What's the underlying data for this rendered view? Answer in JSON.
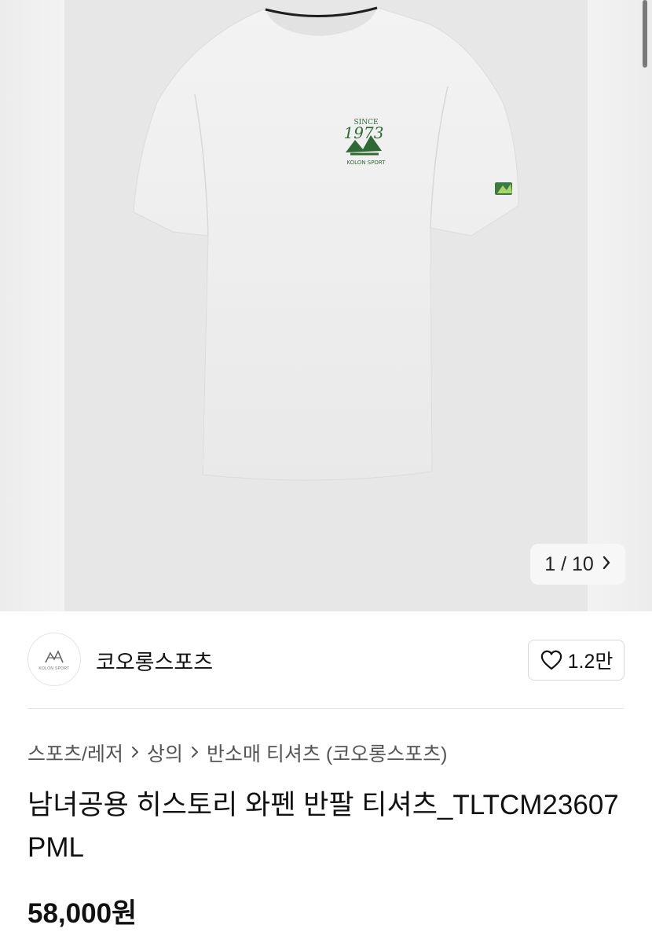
{
  "gallery": {
    "counter_current": "1",
    "counter_sep": "/",
    "counter_total": "10",
    "next_icon": "chevron-right-icon"
  },
  "seller": {
    "name": "코오롱스포츠",
    "like_count": "1.2만",
    "like_icon": "heart-outline-icon"
  },
  "breadcrumb": {
    "items": [
      "스포츠/레저",
      "상의",
      "반소매 티셔츠 (코오롱스포츠)"
    ],
    "separator_icon": "chevron-right-icon"
  },
  "product": {
    "title": "남녀공용 히스토리 와펜 반팔 티셔츠_TLTCM23607PML",
    "price": "58,000원"
  },
  "colors": {
    "tshirt": "#efefef",
    "patch_green": "#2f6a35",
    "background": "#e7e7e7"
  }
}
